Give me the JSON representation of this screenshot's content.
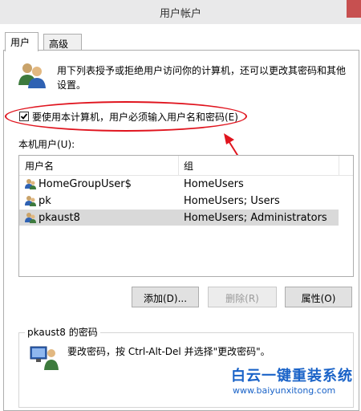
{
  "window": {
    "title": "用户帐户"
  },
  "tabs": [
    {
      "label": "用户"
    },
    {
      "label": "高级"
    }
  ],
  "description": "用下列表授予或拒绝用户访问你的计算机，还可以更改其密码和其他设置。",
  "require_login": {
    "label": "要使用本计算机，用户必须输入用户名和密码(E)",
    "checked": true
  },
  "users_section": {
    "label": "本机用户(U):"
  },
  "table": {
    "headers": [
      "用户名",
      "组"
    ],
    "rows": [
      {
        "user": "HomeGroupUser$",
        "group": "HomeUsers"
      },
      {
        "user": "pk",
        "group": "HomeUsers; Users"
      },
      {
        "user": "pkaust8",
        "group": "HomeUsers; Administrators"
      }
    ],
    "selected_index": 2
  },
  "buttons": {
    "add": "添加(D)...",
    "remove": "删除(R)",
    "properties": "属性(O)"
  },
  "password_group": {
    "title": "pkaust8 的密码",
    "text": "要改密码，按 Ctrl-Alt-Del 并选择\"更改密码\"。"
  },
  "watermark": {
    "title": "白云一键重装系统",
    "url": "www.baiyunxitong.com"
  },
  "colors": {
    "annotation_red": "#e0141e",
    "watermark_blue": "#1a63c8",
    "selected_row": "#d9d9d9"
  }
}
